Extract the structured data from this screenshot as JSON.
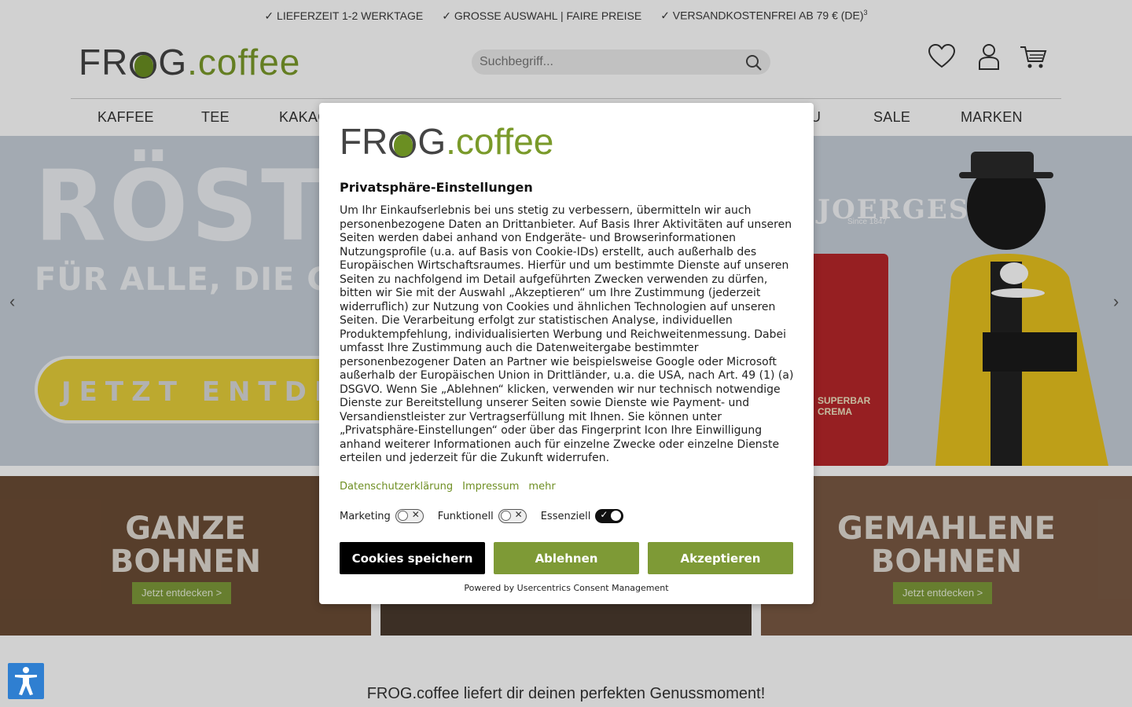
{
  "topbar": {
    "item1": "✓ LIEFERZEIT 1-2 WERKTAGE",
    "item2": "✓ GROSSE AUSWAHL | FAIRE PREISE",
    "item3": "✓ VERSANDKOSTENFREI AB 79 € (DE)",
    "item3_sup": "3"
  },
  "logo": {
    "part1": "FR",
    "part2": "G",
    "part3": ".coffee"
  },
  "search": {
    "placeholder": "Suchbegriff..."
  },
  "nav": {
    "kaffee": "KAFFEE",
    "tee": "TEE",
    "kakao": "KAKAO",
    "item_u": "U",
    "sale": "SALE",
    "marken": "MARKEN"
  },
  "hero": {
    "title": "RÖSTER",
    "subtitle": "FÜR ALLE, DIE GUTEN K",
    "cta": "JETZT ENTDECKE",
    "brand": "JOERGES",
    "brand_since": "Since 1847",
    "bag_text": "SUPERBAR\nCREMA"
  },
  "tiles": {
    "left_line1": "GANZE",
    "left_line2": "BOHNEN",
    "left_btn": "Jetzt entdecken >",
    "right_line1": "GEMAHLENE",
    "right_line2": "BOHNEN",
    "right_btn": "Jetzt entdecken >"
  },
  "tagline": "FROG.coffee liefert dir deinen perfekten Genussmoment!",
  "consent": {
    "title": "Privatsphäre-Einstellungen",
    "body": "Um Ihr Einkaufserlebnis bei uns stetig zu verbessern, übermitteln wir auch personenbezogene Daten an Drittanbieter. Auf Basis Ihrer Aktivitäten auf unseren Seiten werden dabei anhand von Endgeräte- und Browserinformationen Nutzungsprofile (u.a. auf Basis von Cookie-IDs) erstellt, auch außerhalb des Europäischen Wirtschaftsraumes. Hierfür und um bestimmte Dienste auf unseren Seiten zu nachfolgend im Detail aufgeführten Zwecken verwenden zu dürfen, bitten wir Sie mit der Auswahl „Akzeptieren“ um Ihre Zustimmung (jederzeit widerruflich) zur Nutzung von Cookies und ähnlichen Technologien auf unseren Seiten. Die Verarbeitung erfolgt zur statistischen Analyse, individuellen Produktempfehlung, individualisierten Werbung und Reichweitenmessung. Dabei umfasst Ihre Zustimmung auch die Datenweitergabe bestimmter personenbezogener Daten an Partner wie beispielsweise Google oder Microsoft außerhalb der Europäischen Union in Drittländer, u.a. die USA, nach Art. 49 (1) (a) DSGVO. Wenn Sie „Ablehnen“ klicken, verwenden wir nur technisch notwendige Dienste zur Bereitstellung unserer Seiten sowie Dienste wie Payment- und Versandienstleister zur Vertragserfüllung mit Ihnen. Sie können unter „Privatsphäre-Einstellungen“ oder über das Fingerprint Icon Ihre Einwilligung anhand weiterer Informationen auch für einzelne Zwecke oder einzelne Dienste erteilen und jederzeit für die Zukunft widerrufen.",
    "link_privacy": "Datenschutzerklärung",
    "link_imprint": "Impressum",
    "link_more": "mehr",
    "toggle_marketing": "Marketing",
    "toggle_functional": "Funktionell",
    "toggle_essential": "Essenziell",
    "marketing_on": false,
    "functional_on": false,
    "essential_on": true,
    "btn_save": "Cookies speichern",
    "btn_decline": "Ablehnen",
    "btn_accept": "Akzeptieren",
    "powered": "Powered by Usercentrics Consent Management"
  },
  "colors": {
    "brand_green": "#7e9a36",
    "logo_grey": "#444444",
    "hero_bg": "#c7d0da",
    "cta_yellow": "#e6cf3a"
  },
  "icons": [
    "search-icon",
    "heart-icon",
    "user-icon",
    "cart-icon",
    "chevron-left-icon",
    "chevron-right-icon",
    "accessibility-icon",
    "frog-icon"
  ]
}
